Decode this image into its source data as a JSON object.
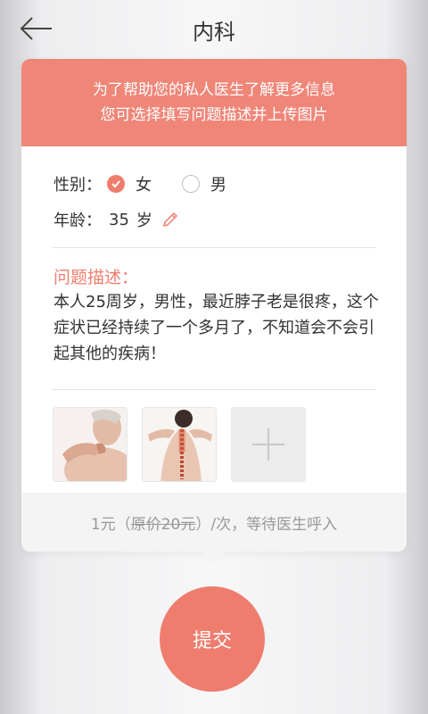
{
  "header": {
    "title": "内科"
  },
  "banner": {
    "line1": "为了帮助您的私人医生了解更多信息",
    "line2": "您可选择填写问题描述并上传图片"
  },
  "gender": {
    "label": "性别：",
    "options": [
      "女",
      "男"
    ],
    "selected": "女"
  },
  "age": {
    "label": "年龄：",
    "value": "35",
    "unit": "岁"
  },
  "description": {
    "label": "问题描述：",
    "text": "本人25周岁，男性，最近脖子老是很疼，这个症状已经持续了一个多月了，不知道会不会引起其他的疾病！"
  },
  "photos": {
    "count": 2
  },
  "pricing": {
    "price": "1元（",
    "original": "原价20元",
    "suffix": "）/次，等待医生呼入"
  },
  "submit": {
    "label": "提交"
  },
  "colors": {
    "accent": "#ef7d6e",
    "banner": "#ef8678"
  }
}
